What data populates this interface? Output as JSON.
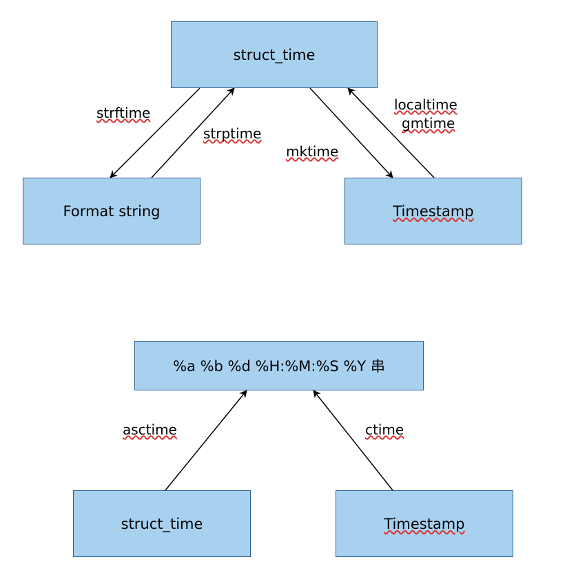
{
  "diagram1": {
    "top": {
      "label": "struct_time"
    },
    "left": {
      "label": "Format string"
    },
    "right": {
      "label": "Timestamp"
    },
    "edges": {
      "strftime": "strftime",
      "strptime": "strptime",
      "mktime": "mktime",
      "localtime": "localtime",
      "gmtime": "gmtime"
    }
  },
  "diagram2": {
    "top": {
      "label": "%a %b %d %H:%M:%S %Y 串"
    },
    "left": {
      "label": "struct_time"
    },
    "right": {
      "label": "Timestamp"
    },
    "edges": {
      "asctime": "asctime",
      "ctime": "ctime"
    }
  }
}
